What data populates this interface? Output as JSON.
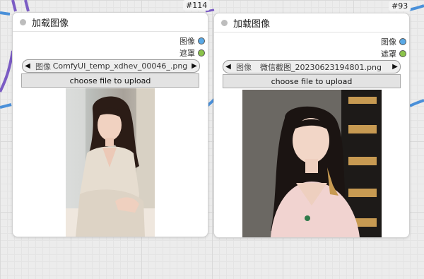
{
  "nodes": [
    {
      "id": "#114",
      "title": "加载图像",
      "outputs": [
        {
          "label": "图像",
          "color": "#5aa9e6"
        },
        {
          "label": "遮罩",
          "color": "#8bc34a"
        }
      ],
      "image_label": "图像",
      "image_value": "ComfyUI_temp_xdhev_00046_.png",
      "upload_label": "choose file to upload",
      "preview_icon": "photo-preview-woman-beige-dress"
    },
    {
      "id": "#93",
      "title": "加载图像",
      "outputs": [
        {
          "label": "图像",
          "color": "#5aa9e6"
        },
        {
          "label": "遮罩",
          "color": "#8bc34a"
        }
      ],
      "image_label": "图像",
      "image_value": "微信截图_20230623194801.png",
      "upload_label": "choose file to upload",
      "preview_icon": "photo-preview-woman-pink-top"
    }
  ],
  "colors": {
    "wire_blue": "#4a90d9",
    "wire_purple": "#7b5cc4",
    "image_slot": "#5aa9e6",
    "mask_slot": "#8bc34a"
  }
}
